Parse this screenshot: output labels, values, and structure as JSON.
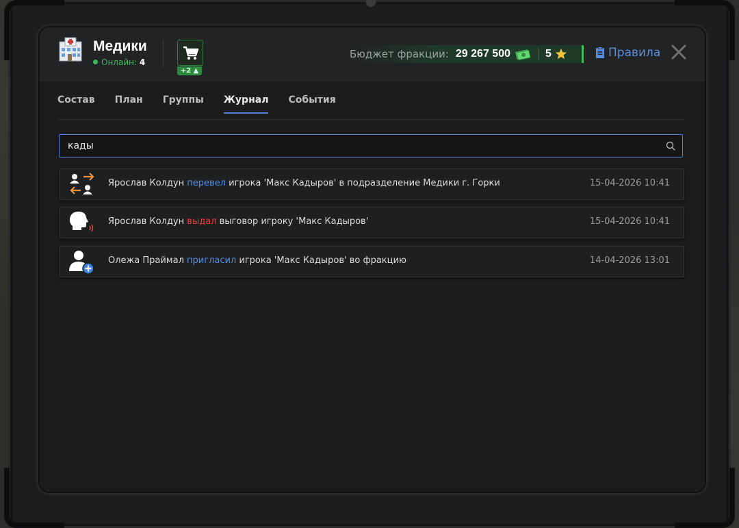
{
  "faction": {
    "name": "Медики",
    "online_label": "Онлайн:",
    "online_count": "4",
    "logo_icon": "hospital-icon"
  },
  "cart": {
    "badge": "+2"
  },
  "budget": {
    "label": "Бюджет фракции:",
    "amount": "29 267 500",
    "stars": "5"
  },
  "rules": {
    "label": "Правила"
  },
  "tabs": [
    {
      "label": "Состав"
    },
    {
      "label": "План"
    },
    {
      "label": "Группы"
    },
    {
      "label": "Журнал",
      "active": true
    },
    {
      "label": "События"
    }
  ],
  "search": {
    "value": "кады"
  },
  "log": [
    {
      "icon": "transfer-users-icon",
      "actor": "Ярослав Колдун",
      "action": "перевел",
      "action_color": "blue",
      "rest": "игрока 'Макс Кадыров' в подразделение Медики г. Горки",
      "time": "15-04-2026 10:41"
    },
    {
      "icon": "speaking-head-icon",
      "actor": "Ярослав Колдун",
      "action": "выдал",
      "action_color": "red",
      "rest": "выговор игроку 'Макс Кадыров'",
      "time": "15-04-2026 10:41"
    },
    {
      "icon": "add-user-icon",
      "actor": "Олежа Праймал",
      "action": "пригласил",
      "action_color": "blue",
      "rest": "игрока 'Макс Кадыров' во фракцию",
      "time": "14-04-2026 13:01"
    }
  ],
  "colors": {
    "accent": "#4d8fe8",
    "danger": "#e0413a",
    "online": "#3cba5a",
    "budget": "#3fbf58"
  }
}
